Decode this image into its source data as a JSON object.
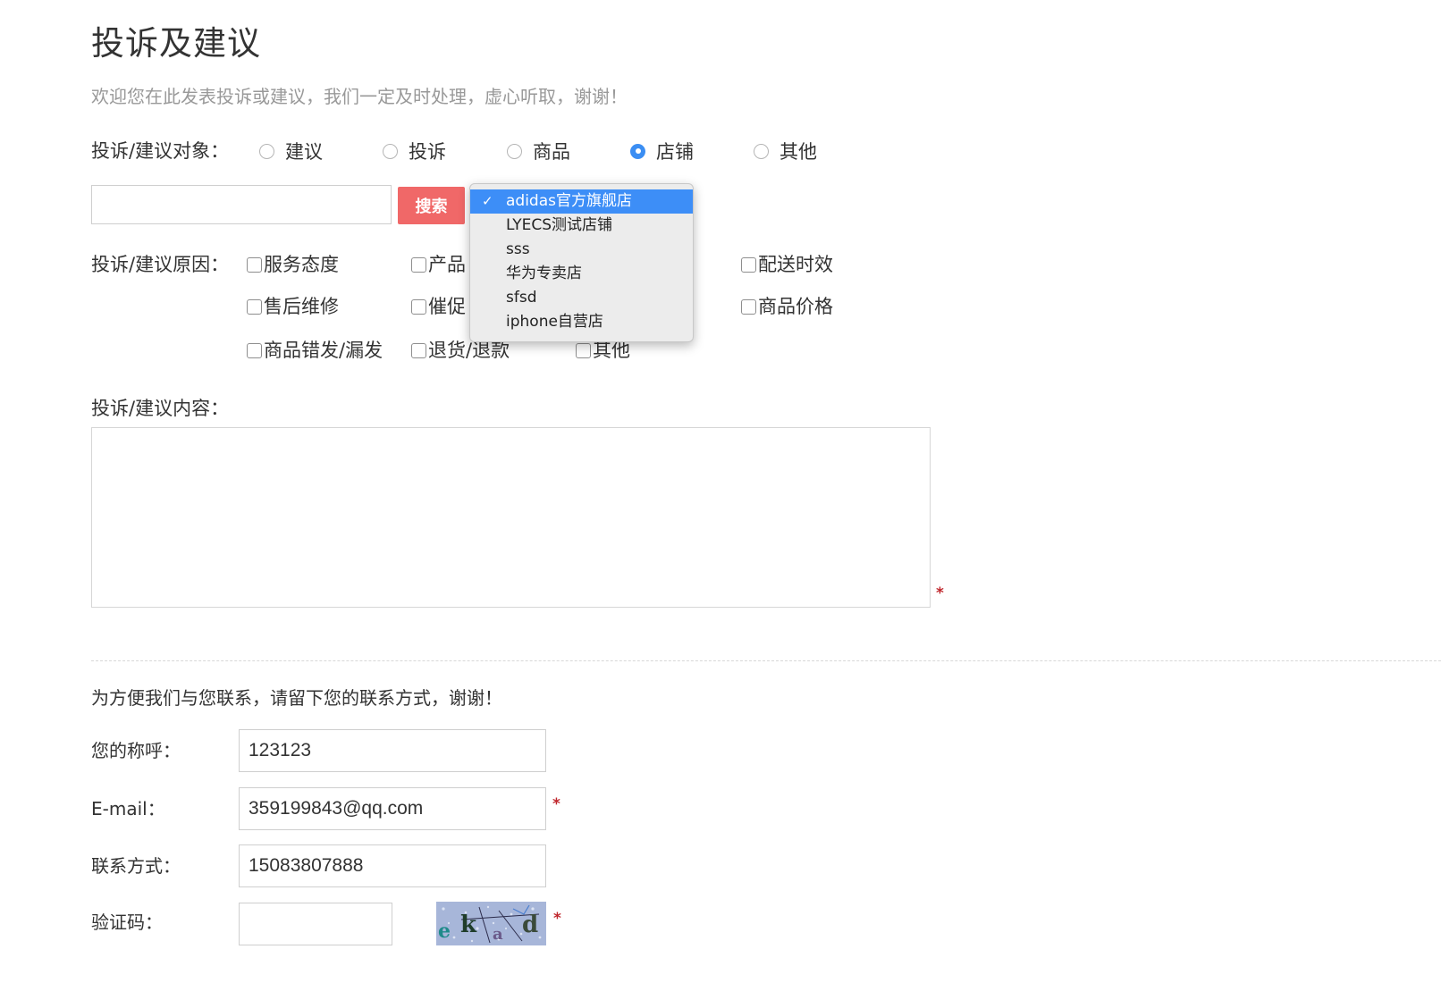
{
  "page": {
    "title": "投诉及建议",
    "subtitle": "欢迎您在此发表投诉或建议，我们一定及时处理，虚心听取，谢谢！"
  },
  "target": {
    "label": "投诉/建议对象：",
    "options": [
      {
        "label": "建议",
        "checked": false
      },
      {
        "label": "投诉",
        "checked": false
      },
      {
        "label": "商品",
        "checked": false
      },
      {
        "label": "店铺",
        "checked": true
      },
      {
        "label": "其他",
        "checked": false
      }
    ],
    "checked_color": "#3b8ef3"
  },
  "search": {
    "value": "",
    "button_label": "搜索",
    "button_color": "#f06868"
  },
  "store_dropdown": {
    "selected_index": 0,
    "check_glyph": "✓",
    "items": [
      "adidas官方旗舰店",
      "LYECS测试店铺",
      "sss",
      "华为专卖店",
      "sfsd",
      "iphone自营店"
    ],
    "highlight_color": "#3d8ef7"
  },
  "reasons": {
    "label": "投诉/建议原因：",
    "visible_items": [
      "服务态度",
      "产品",
      "配送时效",
      "售后维修",
      "催促",
      "商品价格",
      "商品错发/漏发",
      "退货/退款",
      "其他"
    ]
  },
  "content": {
    "label": "投诉/建议内容：",
    "value": "",
    "required_mark": "*"
  },
  "contact": {
    "note": "为方便我们与您联系，请留下您的联系方式，谢谢！",
    "name_label": "您的称呼：",
    "name_value": "123123",
    "email_label": "E-mail：",
    "email_value": "359199843@qq.com",
    "email_required": "*",
    "phone_label": "联系方式：",
    "phone_value": "15083807888",
    "captcha_label": "验证码：",
    "captcha_value": "",
    "captcha_required": "*"
  }
}
